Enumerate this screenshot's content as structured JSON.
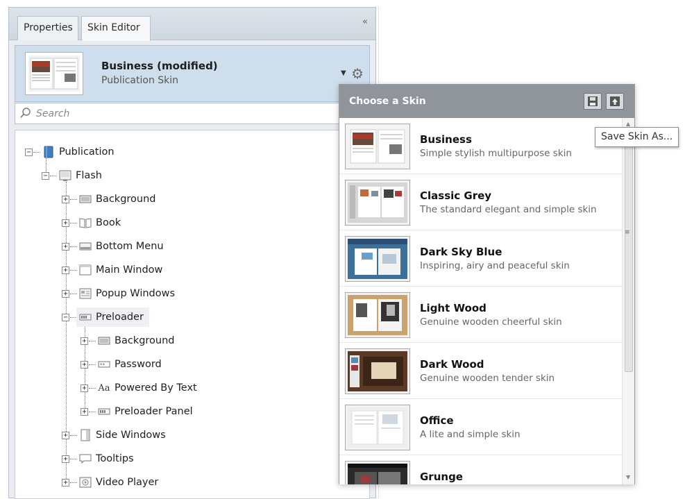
{
  "tabs": [
    {
      "label": "Properties"
    },
    {
      "label": "Skin Editor",
      "active": true
    }
  ],
  "collapse_glyph": "«",
  "current_skin": {
    "name": "Business (modified)",
    "type": "Publication Skin"
  },
  "search": {
    "placeholder": "Search",
    "value": ""
  },
  "tree": {
    "root": "Publication",
    "flash": "Flash",
    "items": [
      {
        "label": "Background",
        "icon": "background-icon"
      },
      {
        "label": "Book",
        "icon": "book-icon"
      },
      {
        "label": "Bottom Menu",
        "icon": "bottom-menu-icon"
      },
      {
        "label": "Main Window",
        "icon": "window-icon"
      },
      {
        "label": "Popup Windows",
        "icon": "popup-windows-icon"
      },
      {
        "label": "Preloader",
        "icon": "preloader-icon",
        "selected": true
      },
      {
        "label": "Side Windows",
        "icon": "side-windows-icon"
      },
      {
        "label": "Tooltips",
        "icon": "tooltip-icon"
      },
      {
        "label": "Video Player",
        "icon": "video-player-icon"
      }
    ],
    "preloader_children": [
      {
        "label": "Background",
        "icon": "background-icon"
      },
      {
        "label": "Password",
        "icon": "password-icon"
      },
      {
        "label": "Powered By Text",
        "icon": "text-icon",
        "glyph": "Aa"
      },
      {
        "label": "Preloader Panel",
        "icon": "preloader-icon"
      }
    ]
  },
  "popup": {
    "title": "Choose a Skin",
    "skins": [
      {
        "name": "Business",
        "desc": "Simple stylish multipurpose skin"
      },
      {
        "name": "Classic Grey",
        "desc": "The standard elegant and simple skin"
      },
      {
        "name": "Dark Sky Blue",
        "desc": "Inspiring, airy and peaceful skin"
      },
      {
        "name": "Light Wood",
        "desc": "Genuine wooden cheerful skin"
      },
      {
        "name": "Dark Wood",
        "desc": "Genuine wooden tender skin"
      },
      {
        "name": "Office",
        "desc": "A lite and simple skin"
      },
      {
        "name": "Grunge",
        "desc": ""
      }
    ]
  },
  "tooltip": "Save Skin As...",
  "colors": {
    "header_bg": "#cfdeed",
    "popup_head": "#8f959b",
    "thumb_light": "#f2f2f2",
    "thumb_wood": "#c9a26d",
    "thumb_darkwood": "#5a3a24",
    "thumb_sky": "#3c6f9a",
    "thumb_dark": "#2b2b2b"
  }
}
